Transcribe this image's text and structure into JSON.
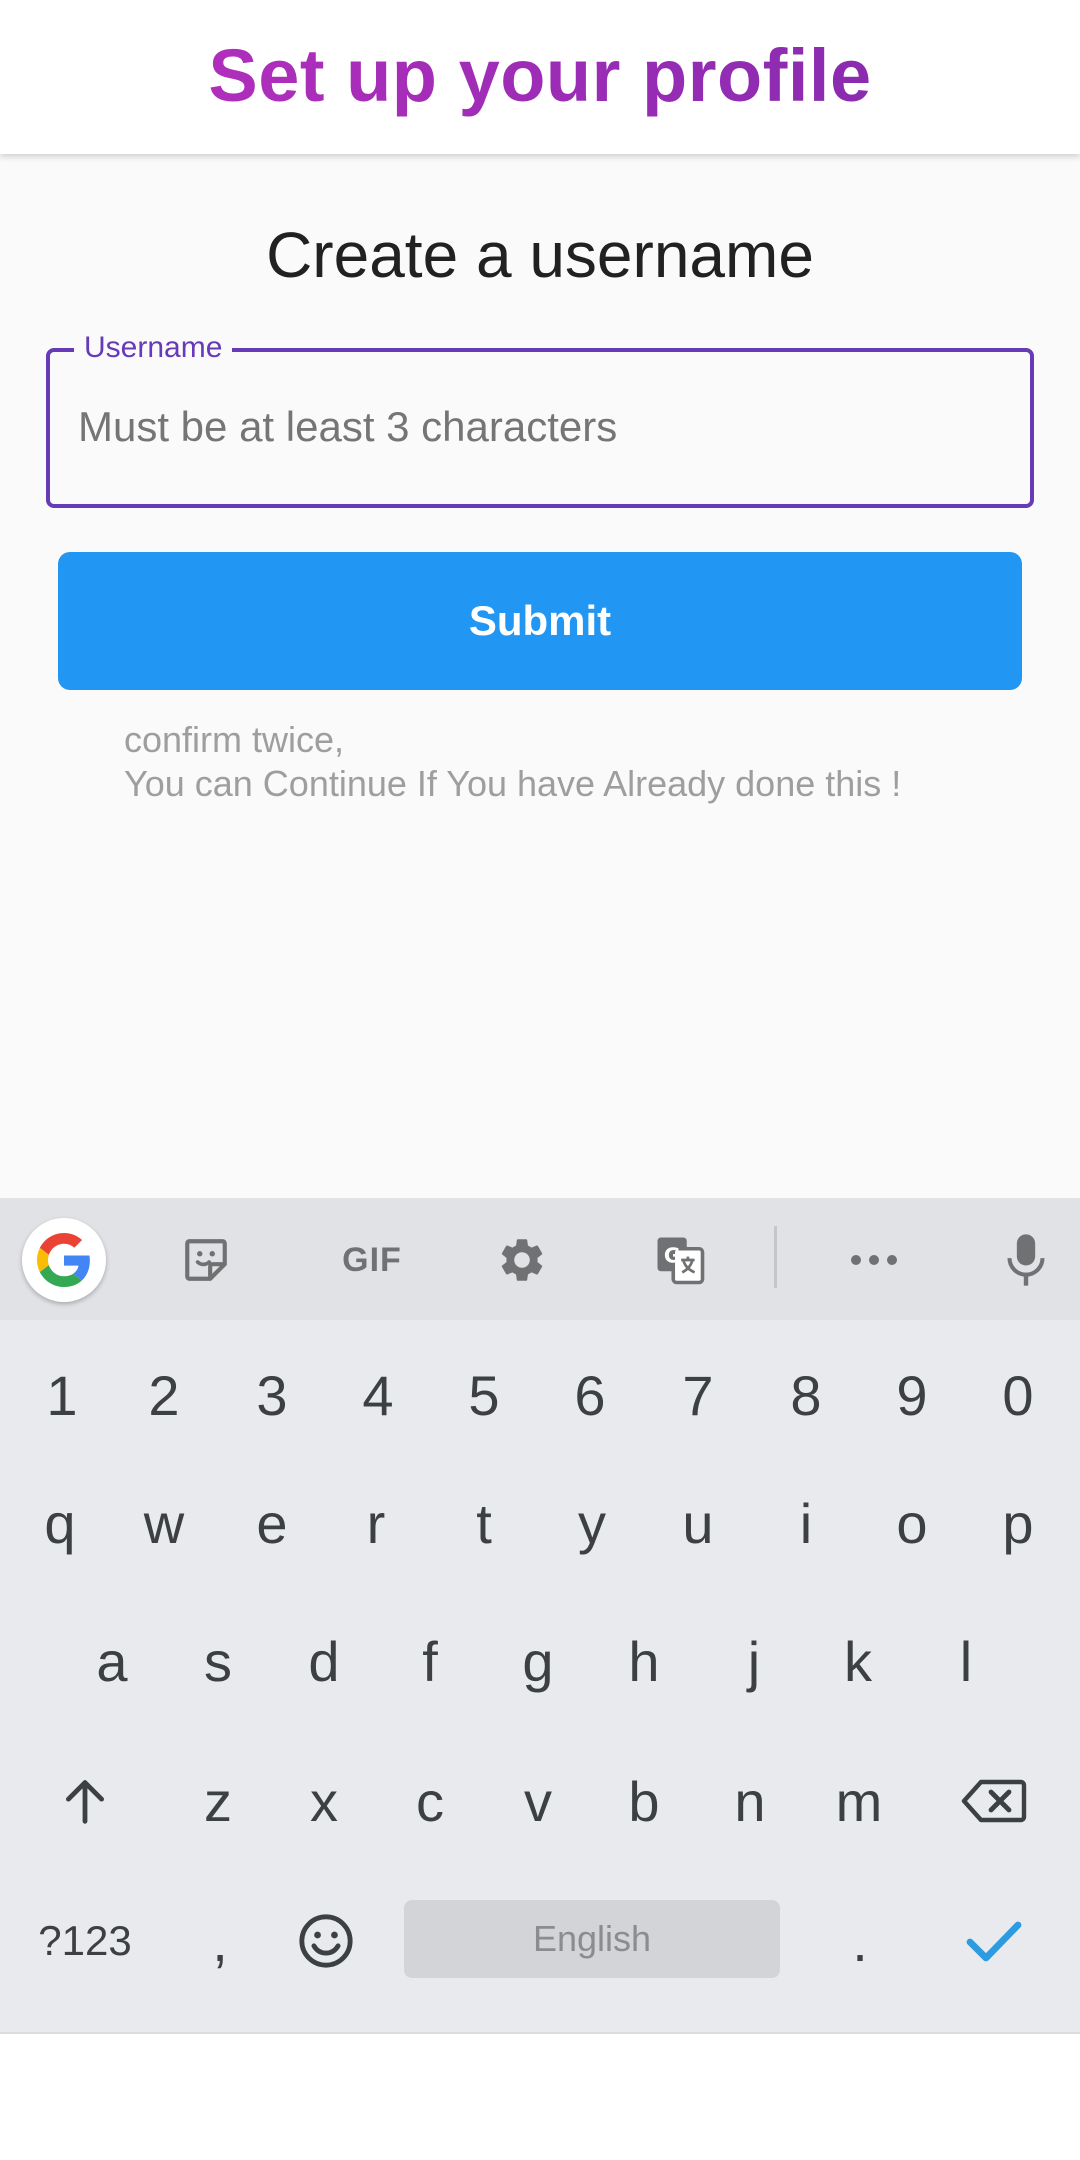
{
  "app_bar": {
    "title": "Set up your profile"
  },
  "form": {
    "heading": "Create a username",
    "username_label": "Username",
    "username_placeholder": "Must be at least 3 characters",
    "username_value": "",
    "submit_label": "Submit",
    "note_line1": "confirm twice,",
    "note_line2": "You can Continue If You have Already done this !"
  },
  "colors": {
    "title_gradient_start": "#b02ebc",
    "title_gradient_end": "#8a2bb0",
    "field_accent": "#673ab7",
    "submit_bg": "#2196f3",
    "keyboard_check": "#2d9be0"
  },
  "keyboard": {
    "toolbar_icons": [
      "google-icon",
      "sticker-icon",
      "gif-icon",
      "settings-icon",
      "translate-icon",
      "more-icon",
      "microphone-icon"
    ],
    "gif_label": "GIF",
    "number_row": [
      "1",
      "2",
      "3",
      "4",
      "5",
      "6",
      "7",
      "8",
      "9",
      "0"
    ],
    "row1": [
      "q",
      "w",
      "e",
      "r",
      "t",
      "y",
      "u",
      "i",
      "o",
      "p"
    ],
    "row2": [
      "a",
      "s",
      "d",
      "f",
      "g",
      "h",
      "j",
      "k",
      "l"
    ],
    "row3": [
      "z",
      "x",
      "c",
      "v",
      "b",
      "n",
      "m"
    ],
    "symbols_label": "?123",
    "comma_label": ",",
    "period_label": ".",
    "space_label": "English"
  }
}
